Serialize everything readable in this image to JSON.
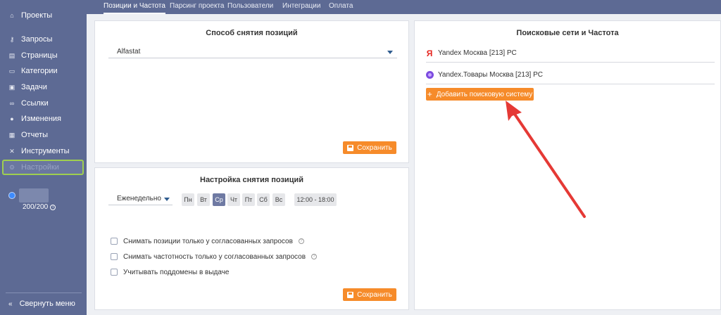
{
  "sidebar": {
    "items": [
      {
        "label": "Проекты",
        "icon": "home-icon"
      },
      {
        "label": "Запросы",
        "icon": "key-icon"
      },
      {
        "label": "Страницы",
        "icon": "page-icon"
      },
      {
        "label": "Категории",
        "icon": "folder-icon"
      },
      {
        "label": "Задачи",
        "icon": "task-icon"
      },
      {
        "label": "Ссылки",
        "icon": "link-icon"
      },
      {
        "label": "Изменения",
        "icon": "changes-icon"
      },
      {
        "label": "Отчеты",
        "icon": "report-icon"
      },
      {
        "label": "Инструменты",
        "icon": "tools-icon"
      },
      {
        "label": "Настройки",
        "icon": "gear-icon"
      }
    ],
    "quota": "200/200",
    "collapse_label": "Свернуть меню"
  },
  "tabs": [
    {
      "label": "Позиции и Частота"
    },
    {
      "label": "Парсинг проекта"
    },
    {
      "label": "Пользователи"
    },
    {
      "label": "Интеграции"
    },
    {
      "label": "Оплата"
    }
  ],
  "method_panel": {
    "title": "Способ снятия позиций",
    "selected": "Alfastat",
    "save_label": "Сохранить"
  },
  "schedule_panel": {
    "title": "Настройка снятия позиций",
    "frequency": "Еженедельно",
    "days": [
      "Пн",
      "Вт",
      "Ср",
      "Чт",
      "Пт",
      "Сб",
      "Вс"
    ],
    "active_day": "Ср",
    "time_range": "12:00 - 18:00",
    "options": [
      {
        "label": "Снимать позиции только у согласованных запросов",
        "help": true
      },
      {
        "label": "Снимать частотность только у согласованных запросов",
        "help": true
      },
      {
        "label": "Учитывать поддомены в выдаче",
        "help": false
      }
    ],
    "save_label": "Сохранить"
  },
  "search_panel": {
    "title": "Поисковые сети и Частота",
    "engines": [
      {
        "icon": "yandex-icon",
        "label": "Yandex Москва [213] PC"
      },
      {
        "icon": "yandex-market-icon",
        "label": "Yandex.Товары Москва [213] PC"
      }
    ],
    "add_label": "Добавить поисковую систему"
  },
  "colors": {
    "sidebar": "#5d6a94",
    "accent": "#f68b2a",
    "highlight": "#9fcf4f",
    "annotation_arrow": "#e53935"
  }
}
